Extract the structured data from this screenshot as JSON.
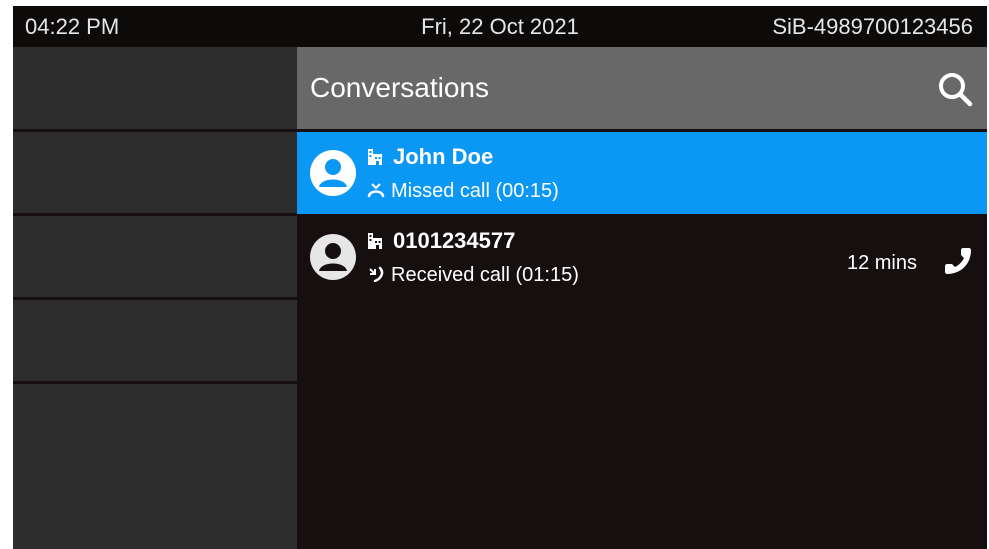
{
  "statusbar": {
    "time": "04:22 PM",
    "date": "Fri, 22 Oct 2021",
    "device_id": "SiB-4989700123456"
  },
  "softkeys": {
    "count": 5
  },
  "panel": {
    "title": "Conversations",
    "search_icon": "search-icon"
  },
  "conversations": [
    {
      "name": "John Doe",
      "detail": "Missed call (00:15)",
      "call_type": "missed",
      "contact_type_icon": "business-contact-icon",
      "selected": true
    },
    {
      "name": "0101234577",
      "detail": "Received call (01:15)",
      "call_type": "received",
      "contact_type_icon": "business-contact-icon",
      "time": "12 mins",
      "action_icon": "phone-icon",
      "selected": false
    }
  ],
  "colors": {
    "background": "#150f0f",
    "header": "#686868",
    "selected": "#0b97f4",
    "softkey": "#2d2d2d"
  }
}
